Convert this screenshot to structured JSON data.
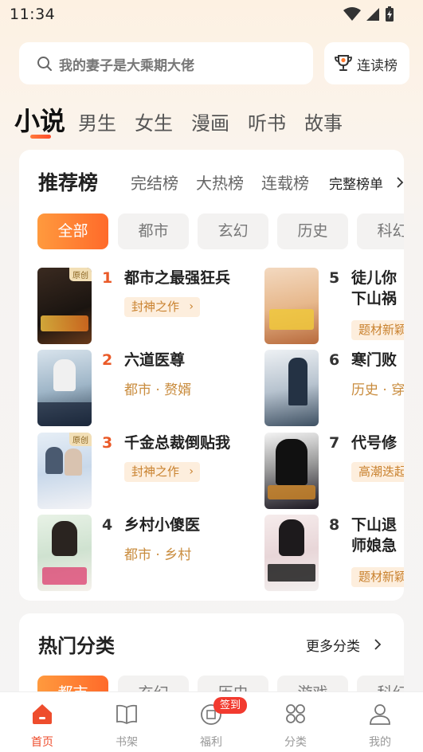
{
  "status": {
    "time": "11:34"
  },
  "search": {
    "placeholder": "我的妻子是大乘期大佬"
  },
  "lianbang": {
    "label": "连读榜"
  },
  "top_tabs": [
    "小说",
    "男生",
    "女生",
    "漫画",
    "听书",
    "故事"
  ],
  "ranking": {
    "tabs": [
      "推荐榜",
      "完结榜",
      "大热榜",
      "连载榜"
    ],
    "full_list": "完整榜单",
    "chips": [
      "全部",
      "都市",
      "玄幻",
      "历史",
      "科幻"
    ],
    "books": [
      {
        "rank": "1",
        "title": "都市之最强狂兵",
        "tag": "封神之作"
      },
      {
        "rank": "2",
        "title": "六道医尊",
        "meta": "都市 · 赘婿"
      },
      {
        "rank": "3",
        "title": "千金总裁倒贴我",
        "tag": "封神之作"
      },
      {
        "rank": "4",
        "title": "乡村小傻医",
        "meta": "都市 · 乡村"
      },
      {
        "rank": "5",
        "title": "徒儿你下山祸",
        "tag": "题材新颖"
      },
      {
        "rank": "6",
        "title": "寒门败",
        "meta": "历史 · 穿"
      },
      {
        "rank": "7",
        "title": "代号修",
        "tag": "高潮迭起"
      },
      {
        "rank": "8",
        "title": "下山退师娘急",
        "tag": "题材新颖"
      }
    ],
    "badge_original": "原创"
  },
  "hot_categories": {
    "title": "热门分类",
    "more": "更多分类",
    "chips": [
      "都市",
      "玄幻",
      "历史",
      "游戏",
      "科幻"
    ]
  },
  "tabbar": {
    "items": [
      "首页",
      "书架",
      "福利",
      "分类",
      "我的"
    ],
    "checkin": "签到"
  },
  "colors": {
    "accent": "#ff6a2a",
    "active_tab": "#ee4d2d",
    "tag_text": "#c9822f"
  }
}
